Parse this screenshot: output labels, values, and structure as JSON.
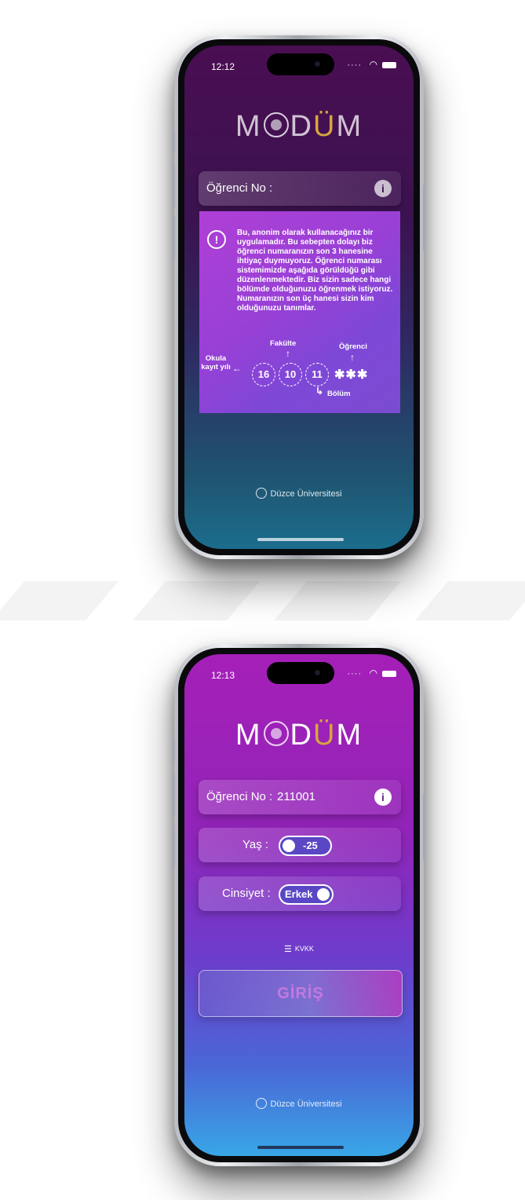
{
  "app": {
    "logo": "MODUM",
    "footer": "Düzce Üniversitesi"
  },
  "screen1": {
    "status": {
      "time": "12:12"
    },
    "student_no_label": "Öğrenci No :",
    "tooltip": {
      "text": "Bu, anonim olarak kullanacağınız bir uygulamadır. Bu sebepten dolayı biz öğrenci numaranızın son 3 hanesine ihtiyaç duymuyoruz. Öğrenci numarası sistemimizde aşağıda görüldüğü gibi düzenlenmektedir. Biz sizin sadece hangi bölümde olduğunuzu öğrenmek istiyoruz. Numaranızın son üç hanesi sizin kim olduğunuzu tanımlar.",
      "diagram": {
        "label_year": "Okula kayıt yılı",
        "label_faculty": "Fakülte",
        "label_student": "Öğrenci",
        "label_department": "Bölüm",
        "digits": [
          "16",
          "10",
          "11"
        ],
        "masked": "✱✱✱"
      }
    }
  },
  "screen2": {
    "status": {
      "time": "12:13"
    },
    "student_no_label": "Öğrenci No :",
    "student_no_value": "211001",
    "age_label": "Yaş :",
    "age_value": "-25",
    "gender_label": "Cinsiyet :",
    "gender_value": "Erkek",
    "kvkk_label": "KVKK",
    "login_button": "GİRİŞ"
  }
}
